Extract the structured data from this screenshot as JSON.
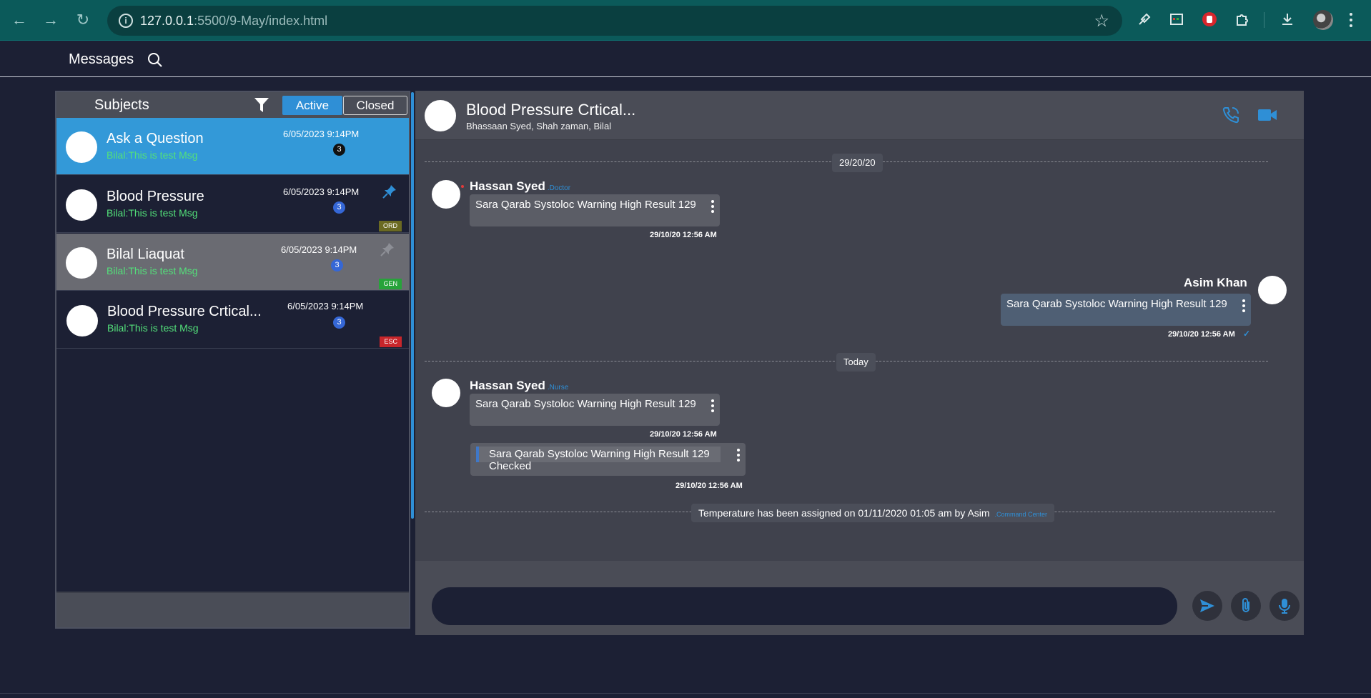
{
  "browser": {
    "url_host": "127.0.0.1",
    "url_path": ":5500/9-May/index.html"
  },
  "app": {
    "title": "Messages"
  },
  "subjects_panel": {
    "title": "Subjects",
    "tab_active": "Active",
    "tab_closed": "Closed",
    "items": [
      {
        "name": "Ask a Question",
        "preview": "Bilal:This is test Msg",
        "time": "6/05/2023 9:14PM",
        "count": "3",
        "tag": "",
        "state": "selected"
      },
      {
        "name": "Blood Pressure",
        "preview": "Bilal:This is test Msg",
        "time": "6/05/2023 9:14PM",
        "count": "3",
        "tag": "ORD",
        "state": "pinned"
      },
      {
        "name": "Bilal Liaquat",
        "preview": "Bilal:This is test Msg",
        "time": "6/05/2023 9:14PM",
        "count": "3",
        "tag": "GEN",
        "state": "hover"
      },
      {
        "name": "Blood Pressure Crtical...",
        "preview": "Bilal:This is test Msg",
        "time": "6/05/2023 9:14PM",
        "count": "3",
        "tag": "ESC",
        "state": "normal"
      }
    ]
  },
  "chat": {
    "title": "Blood Pressure Crtical...",
    "members": "Bhassaan Syed, Shah zaman, Bilal",
    "date_divider_1": "29/20/20",
    "date_divider_2": "Today",
    "messages": [
      {
        "sender": "Hassan Syed",
        "role": ".Doctor",
        "text": "Sara Qarab Systoloc Warning High Result 129",
        "time": "29/10/20 12:56 AM"
      },
      {
        "sender": "Asim Khan",
        "role": "",
        "text": "Sara Qarab Systoloc Warning High Result 129",
        "time": "29/10/20 12:56 AM",
        "status": "✓"
      },
      {
        "sender": "Hassan Syed",
        "role": ".Nurse",
        "text": "Sara Qarab Systoloc Warning High Result 129",
        "time": "29/10/20 12:56 AM"
      },
      {
        "sender": "",
        "quoted": "Sara Qarab Systoloc Warning High Result 129",
        "text": "Checked",
        "time": "29/10/20 12:56 AM"
      }
    ],
    "system_note": "Temperature has been assigned on 01/11/2020 01:05 am by Asim",
    "system_note_role": ".Command Center",
    "composer_placeholder": ""
  },
  "colors": {
    "accent": "#2f8fd6",
    "background": "#1c2034",
    "preview_green": "#53e07a",
    "tag_ord": "#6b6a22",
    "tag_gen": "#27a33a",
    "tag_esc": "#c8262b"
  }
}
